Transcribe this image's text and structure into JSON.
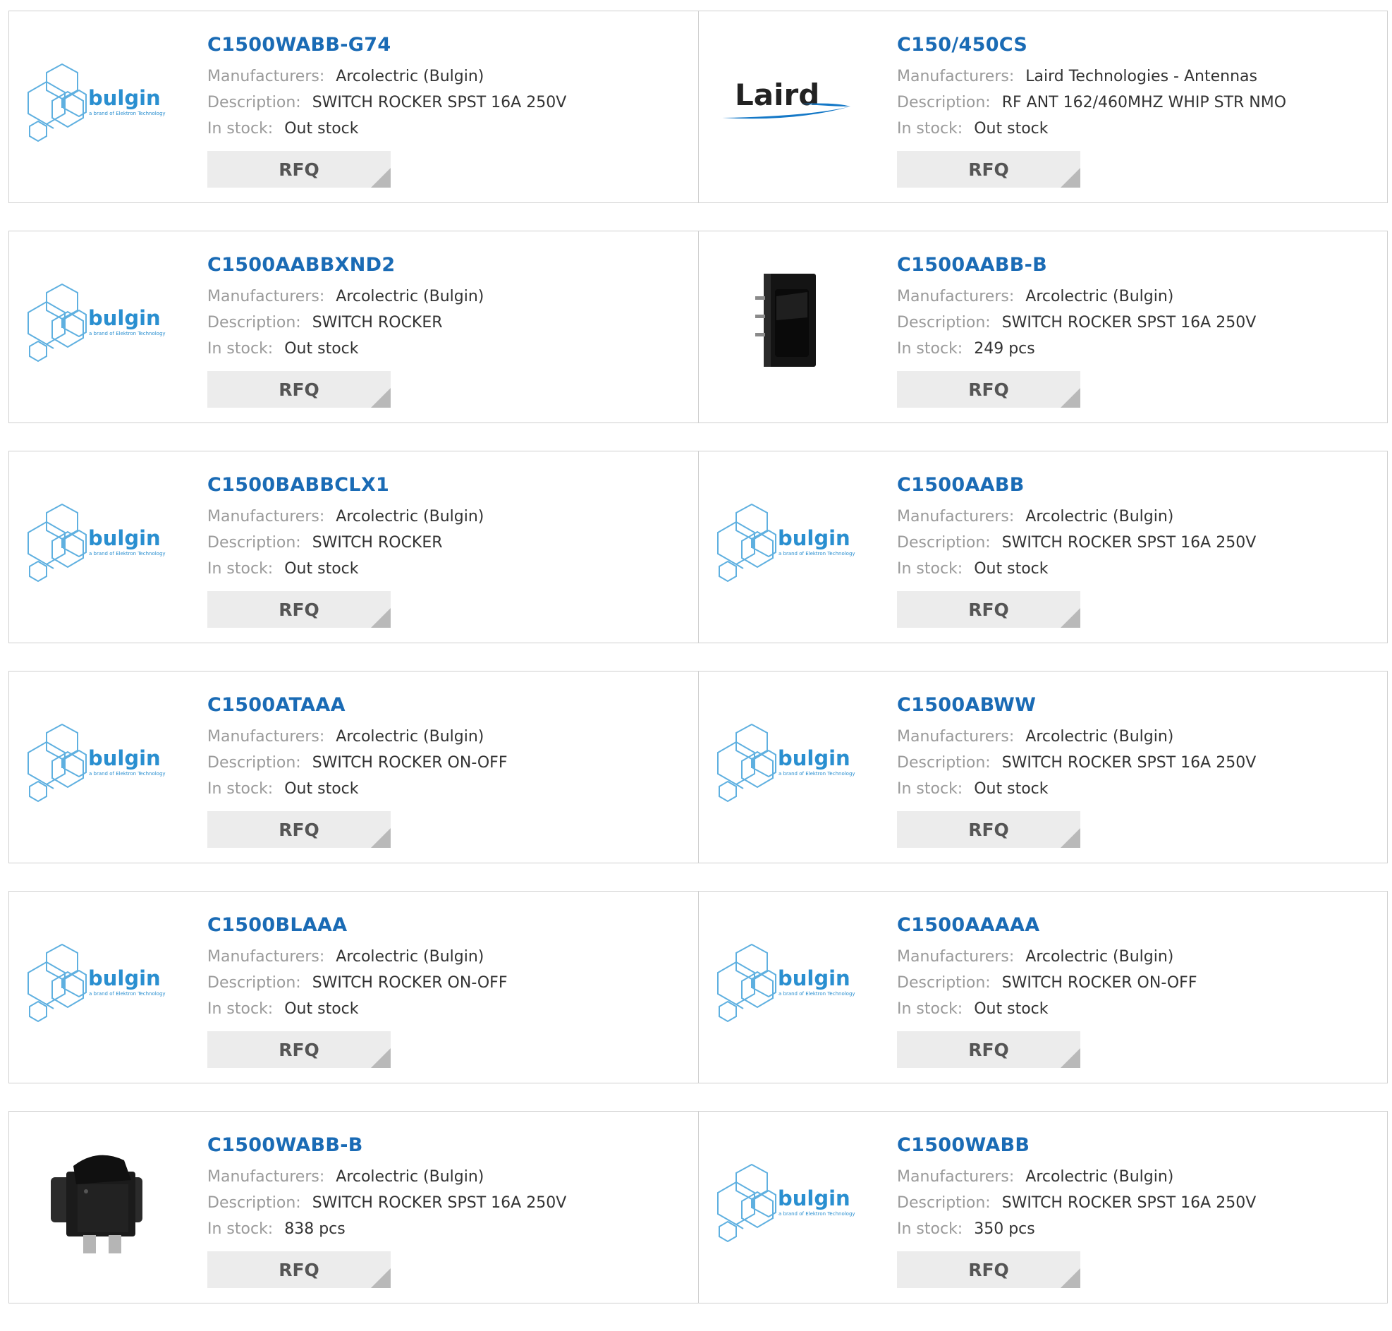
{
  "labels": {
    "manufacturers": "Manufacturers:",
    "description": "Description:",
    "in_stock": "In stock:",
    "rfq": "RFQ"
  },
  "logo_text": {
    "bulgin": "bulgin",
    "bulgin_tagline": "a brand of Elektron Technology",
    "laird": "Laird"
  },
  "colors": {
    "link": "#1a6bb5",
    "bulgin_blue": "#2a8fd0",
    "laird_blue": "#1478c7",
    "border": "#cfcfcf",
    "rfq_bg": "#ececec"
  },
  "products": [
    {
      "part": "C1500WABB-G74",
      "manufacturer": "Arcolectric (Bulgin)",
      "description": "SWITCH ROCKER SPST 16A 250V",
      "stock": "Out stock",
      "image": "bulgin-logo"
    },
    {
      "part": "C150/450CS",
      "manufacturer": "Laird Technologies - Antennas",
      "description": "RF ANT 162/460MHZ WHIP STR NMO",
      "stock": "Out stock",
      "image": "laird-logo"
    },
    {
      "part": "C1500AABBXND2",
      "manufacturer": "Arcolectric (Bulgin)",
      "description": "SWITCH ROCKER",
      "stock": "Out stock",
      "image": "bulgin-logo"
    },
    {
      "part": "C1500AABB-B",
      "manufacturer": "Arcolectric (Bulgin)",
      "description": "SWITCH ROCKER SPST 16A 250V",
      "stock": "249 pcs",
      "image": "rocker-switch-side-photo"
    },
    {
      "part": "C1500BABBCLX1",
      "manufacturer": "Arcolectric (Bulgin)",
      "description": "SWITCH ROCKER",
      "stock": "Out stock",
      "image": "bulgin-logo"
    },
    {
      "part": "C1500AABB",
      "manufacturer": "Arcolectric (Bulgin)",
      "description": "SWITCH ROCKER SPST 16A 250V",
      "stock": "Out stock",
      "image": "bulgin-logo"
    },
    {
      "part": "C1500ATAAA",
      "manufacturer": "Arcolectric (Bulgin)",
      "description": "SWITCH ROCKER ON-OFF",
      "stock": "Out stock",
      "image": "bulgin-logo"
    },
    {
      "part": "C1500ABWW",
      "manufacturer": "Arcolectric (Bulgin)",
      "description": "SWITCH ROCKER SPST 16A 250V",
      "stock": "Out stock",
      "image": "bulgin-logo"
    },
    {
      "part": "C1500BLAAA",
      "manufacturer": "Arcolectric (Bulgin)",
      "description": "SWITCH ROCKER ON-OFF",
      "stock": "Out stock",
      "image": "bulgin-logo"
    },
    {
      "part": "C1500AAAAA",
      "manufacturer": "Arcolectric (Bulgin)",
      "description": "SWITCH ROCKER ON-OFF",
      "stock": "Out stock",
      "image": "bulgin-logo"
    },
    {
      "part": "C1500WABB-B",
      "manufacturer": "Arcolectric (Bulgin)",
      "description": "SWITCH ROCKER SPST 16A 250V",
      "stock": "838 pcs",
      "image": "rocker-switch-front-photo"
    },
    {
      "part": "C1500WABB",
      "manufacturer": "Arcolectric (Bulgin)",
      "description": "SWITCH ROCKER SPST 16A 250V",
      "stock": "350 pcs",
      "image": "bulgin-logo"
    }
  ]
}
